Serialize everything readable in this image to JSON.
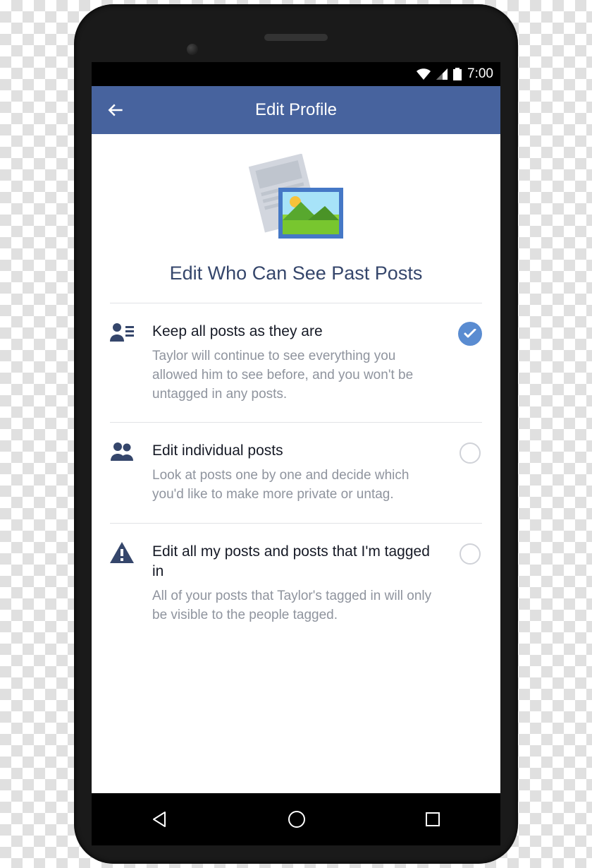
{
  "statusbar": {
    "time": "7:00"
  },
  "appbar": {
    "title": "Edit Profile"
  },
  "page": {
    "title": "Edit Who Can See Past Posts"
  },
  "options": [
    {
      "icon": "person-list-icon",
      "title": "Keep all posts as they are",
      "desc": "Taylor will continue to see everything you allowed him to see before, and you won't be untagged in any posts.",
      "checked": true
    },
    {
      "icon": "people-icon",
      "title": "Edit individual posts",
      "desc": "Look at posts one by one and decide which you'd like to make more private or untag.",
      "checked": false
    },
    {
      "icon": "warning-icon",
      "title": "Edit all my posts and posts that I'm tagged in",
      "desc": "All of your posts that Taylor's tagged in will only be visible to the people tagged.",
      "checked": false
    }
  ]
}
